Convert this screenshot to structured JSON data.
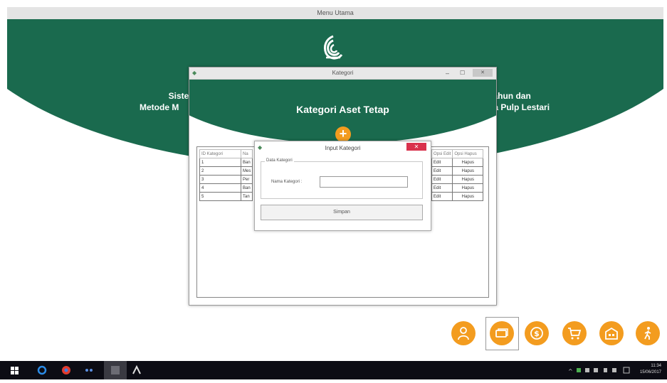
{
  "main_window": {
    "title": "Menu Utama",
    "app_title_left_line1": "Sister",
    "app_title_left_line2": "Metode M",
    "app_title_right_line1": "Tahun dan",
    "app_title_right_line2": "ba Pulp Lestari"
  },
  "kategori_window": {
    "title": "Kategori",
    "heading": "Kategori Aset Tetap",
    "add_button_label": "+",
    "table": {
      "headers": [
        "ID Kategori",
        "Na",
        "",
        "Opsi Edit",
        "Opsi Hapus"
      ],
      "rows": [
        {
          "id": "1",
          "name": "Ban",
          "edit": "Edit",
          "delete": "Hapus"
        },
        {
          "id": "2",
          "name": "Mes",
          "edit": "Edit",
          "delete": "Hapus"
        },
        {
          "id": "3",
          "name": "Per",
          "edit": "Edit",
          "delete": "Hapus"
        },
        {
          "id": "4",
          "name": "Ban",
          "edit": "Edit",
          "delete": "Hapus"
        },
        {
          "id": "5",
          "name": "Tan",
          "edit": "Edit",
          "delete": "Hapus"
        }
      ]
    }
  },
  "input_dialog": {
    "title": "Input Kategori",
    "close_label": "✕",
    "group_label": "Data Kategori",
    "field_label": "Nama Kategori :",
    "field_value": "",
    "save_label": "Simpan"
  },
  "nav_icons": [
    {
      "name": "user-icon"
    },
    {
      "name": "asset-icon",
      "selected": true
    },
    {
      "name": "money-icon"
    },
    {
      "name": "cart-icon"
    },
    {
      "name": "building-icon"
    },
    {
      "name": "exit-icon"
    }
  ],
  "taskbar": {
    "time": "11:34",
    "date": "15/06/2017"
  },
  "colors": {
    "brand_green": "#1a6a4e",
    "accent_orange": "#f39c1f",
    "close_red": "#d9324d"
  }
}
